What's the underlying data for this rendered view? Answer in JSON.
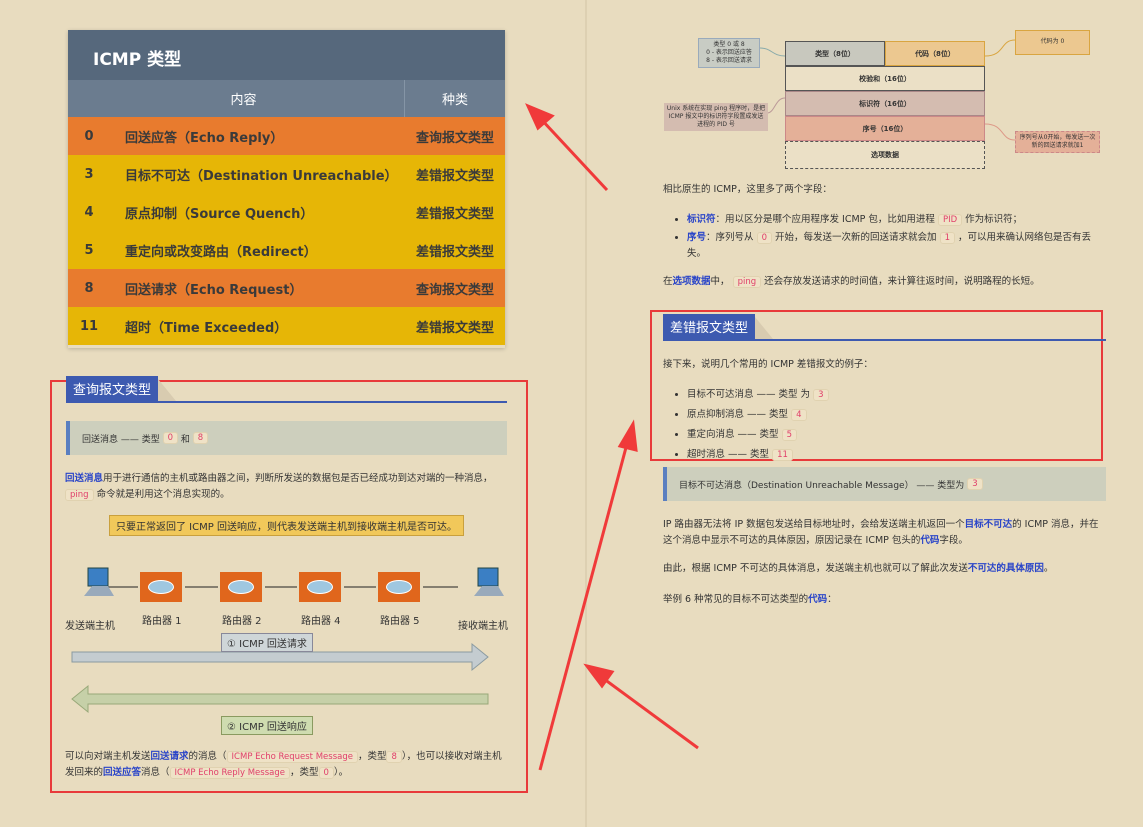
{
  "table": {
    "title": "ICMP 类型",
    "headers": [
      "内容",
      "种类"
    ],
    "rows": [
      {
        "n": "0",
        "content": "回送应答（Echo Reply）",
        "kind": "查询报文类型",
        "color": "orange"
      },
      {
        "n": "3",
        "content": "目标不可达（Destination Unreachable）",
        "kind": "差错报文类型",
        "color": "yellow"
      },
      {
        "n": "4",
        "content": "原点抑制（Source Quench）",
        "kind": "差错报文类型",
        "color": "yellow"
      },
      {
        "n": "5",
        "content": "重定向或改变路由（Redirect）",
        "kind": "差错报文类型",
        "color": "yellow"
      },
      {
        "n": "8",
        "content": "回送请求（Echo Request）",
        "kind": "查询报文类型",
        "color": "orange"
      },
      {
        "n": "11",
        "content": "超时（Time Exceeded）",
        "kind": "差错报文类型",
        "color": "yellow"
      }
    ]
  },
  "query": {
    "heading": "查询报文类型",
    "quote": "回送消息 —— 类型",
    "q0": "0",
    "qand": "和",
    "q8": "8",
    "p1_link": "回送消息",
    "p1a": "用于进行通信的主机或路由器之间，判断所发送的数据包是否已经成功到达对端的一种消息，",
    "p1_code": "ping",
    "p1b": "命令就是利用这个消息实现的。",
    "note": "只要正常返回了 ICMP 回送响应，则代表发送端主机到接收端主机是否可达。",
    "nodes": [
      "发送端主机",
      "路由器 1",
      "路由器 2",
      "路由器 4",
      "路由器 5",
      "接收端主机"
    ],
    "req": "① ICMP 回送请求",
    "resp": "② ICMP 回送响应",
    "p2a": "可以向对端主机发送",
    "p2_l1": "回送请求",
    "p2b": "的消息（",
    "p2_c1": "ICMP Echo Request Message",
    "p2c": "，类型",
    "p2_c2": "8",
    "p2d": "），也可以接收对端主机发回来的",
    "p2_l2": "回送应答",
    "p2e": "消息（",
    "p2_c3": "ICMP Echo Reply Message",
    "p2f": "，类型",
    "p2_c4": "0",
    "p2g": "）。"
  },
  "header_diagram": {
    "type_note": [
      "类型 0 或 8",
      "0 - 表示回送应答",
      "8 - 表示回送请求"
    ],
    "type": "类型（8位）",
    "code": "代码（8位）",
    "code_note": "代码为 0",
    "checksum": "校验和（16位）",
    "id": "标识符（16位）",
    "id_note": "Unix 系统在实现 ping 程序时，是把 ICMP 报文中的标识符字段置成发送进程的 PID 号",
    "seq": "序号（16位）",
    "seq_note": "序列号从0开始，每发送一次新的回送请求就加1",
    "options": "选项数据"
  },
  "fields": {
    "intro": "相比原生的 ICMP，这里多了两个字段：",
    "i1_l": "标识符",
    "i1a": "：用以区分是哪个应用程序发 ICMP 包，比如用进程",
    "i1_c": "PID",
    "i1b": "作为标识符；",
    "i2_l": "序号",
    "i2a": "：序列号从",
    "i2_c1": "0",
    "i2b": "开始，每发送一次新的回送请求就会加",
    "i2_c2": "1",
    "i2c": "，可以用来确认网络包是否有丢失。",
    "o_a": "在",
    "o_l": "选项数据",
    "o_b": "中，",
    "o_c": "ping",
    "o_d": "还会存放发送请求的时间值，来计算往返时间，说明路程的长短。"
  },
  "error": {
    "heading": "差错报文类型",
    "intro": "接下来，说明几个常用的 ICMP 差错报文的例子：",
    "items": [
      {
        "t": "目标不可达消息 —— 类型 为",
        "c": "3"
      },
      {
        "t": "原点抑制消息 —— 类型",
        "c": "4"
      },
      {
        "t": "重定向消息 —— 类型",
        "c": "5"
      },
      {
        "t": "超时消息 —— 类型",
        "c": "11"
      }
    ],
    "quote": "目标不可达消息（Destination Unreachable Message） —— 类型为",
    "qc": "3",
    "p1a": "IP 路由器无法将 IP 数据包发送给目标地址时，会给发送端主机返回一个",
    "p1_l1": "目标不可达",
    "p1b": "的 ICMP 消息，并在这个消息中显示不可达的具体原因，原因记录在 ICMP 包头的",
    "p1_l2": "代码",
    "p1c": "字段。",
    "p2a": "由此，根据 ICMP 不可达的具体消息，发送端主机也就可以了解此次发送",
    "p2_l": "不可达的具体原因",
    "p2b": "。",
    "p3a": "举例 6 种常见的目标不可达类型的",
    "p3_l": "代码",
    "p3b": "："
  },
  "colors": {
    "highlight": "#e83a3a",
    "link": "#2a45c8",
    "orange": "#e87b2e",
    "yellow": "#e6b606"
  }
}
